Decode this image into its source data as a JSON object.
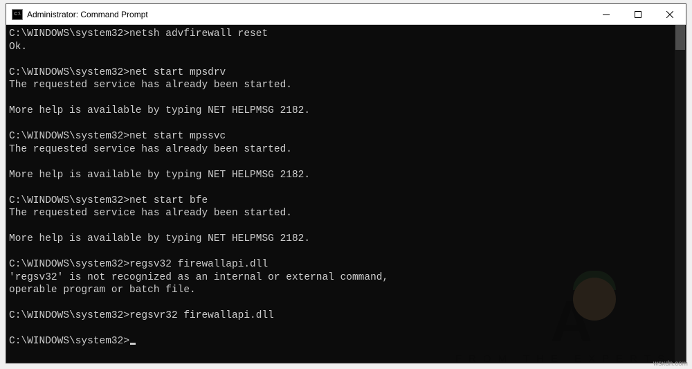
{
  "window": {
    "title": "Administrator: Command Prompt",
    "icon_name": "cmd-icon",
    "icon_text": "C:\\"
  },
  "controls": {
    "minimize": "minimize",
    "maximize": "maximize",
    "close": "close"
  },
  "terminal": {
    "prompt": "C:\\WINDOWS\\system32>",
    "blocks": [
      {
        "cmd": "netsh advfirewall reset",
        "out": "Ok."
      },
      {
        "cmd": "net start mpsdrv",
        "out": "The requested service has already been started.\n\nMore help is available by typing NET HELPMSG 2182."
      },
      {
        "cmd": "net start mpssvc",
        "out": "The requested service has already been started.\n\nMore help is available by typing NET HELPMSG 2182."
      },
      {
        "cmd": "net start bfe",
        "out": "The requested service has already been started.\n\nMore help is available by typing NET HELPMSG 2182."
      },
      {
        "cmd": "regsv32 firewallapi.dll",
        "out": "'regsv32' is not recognized as an internal or external command,\noperable program or batch file."
      },
      {
        "cmd": "regsvr32 firewallapi.dll",
        "out": ""
      }
    ]
  },
  "watermark": {
    "big": "A",
    "brand": "UALS",
    "sub": "FROM   THE   EXPERTS"
  },
  "attr": "wsxdn.com"
}
